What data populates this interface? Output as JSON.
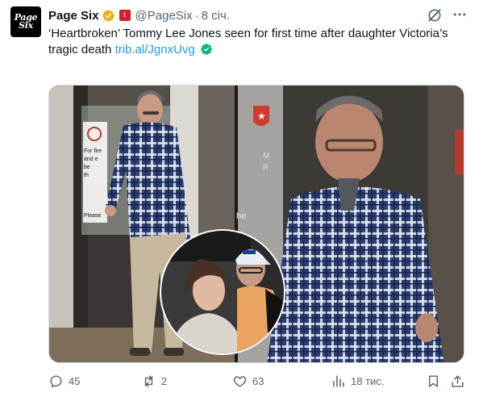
{
  "account": {
    "avatar_text": [
      "Page",
      "Six"
    ],
    "name": "Page Six",
    "handle": "@PageSix",
    "separator": "·",
    "time": "8 січ."
  },
  "post": {
    "text": "‘Heartbroken’ Tommy Lee Jones seen for first time after daughter Victoria’s tragic death",
    "link": "trib.al/JgnxUvg",
    "image_sign_text": [
      "For fire",
      "and e",
      "be",
      "th",
      "Please",
      "M",
      "R",
      "he"
    ]
  },
  "actions": {
    "replies": "45",
    "reposts": "2",
    "likes": "63",
    "views": "18 тис."
  },
  "colors": {
    "verified_gold": "#e2b719",
    "link_blue": "#1d9bf0",
    "check_green": "#00ba7c",
    "secondary_text": "#536471",
    "affiliate_red": "#d51e2b"
  },
  "icons": [
    "verified-badge-icon",
    "affiliate-badge-icon",
    "grok-icon",
    "more-icon",
    "check-emoji-icon",
    "reply-icon",
    "repost-icon",
    "like-icon",
    "views-icon",
    "bookmark-icon",
    "share-icon"
  ]
}
